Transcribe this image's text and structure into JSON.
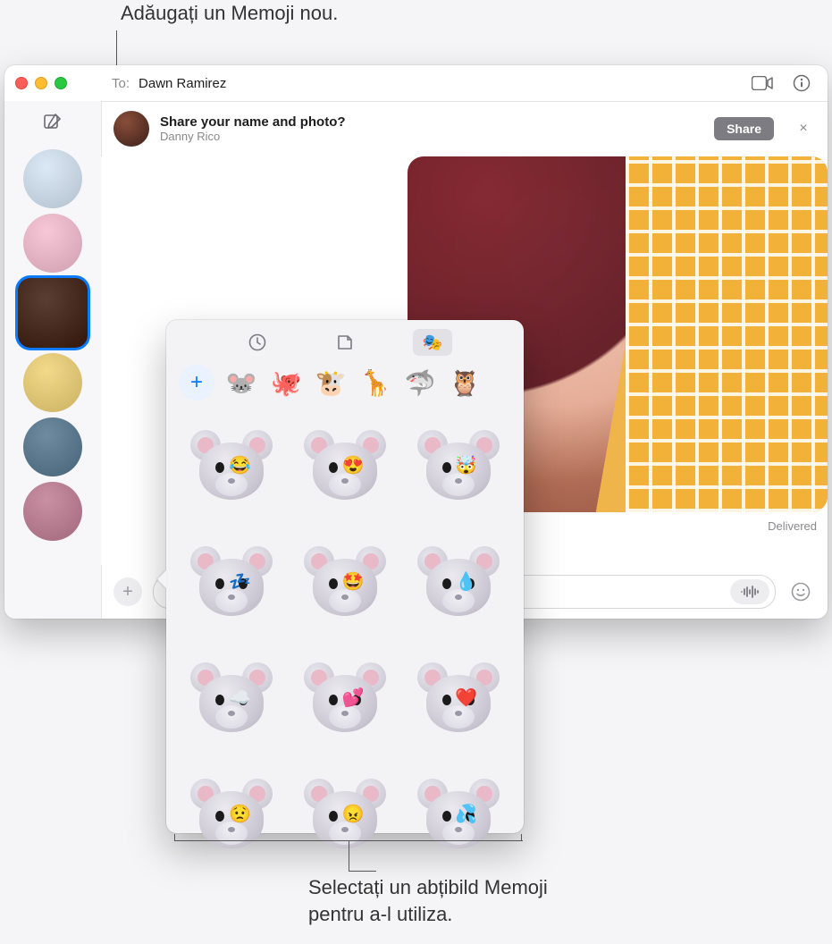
{
  "callouts": {
    "top": "Adăugați un Memoji nou.",
    "bottom_line1": "Selectați un abțibild Memoji",
    "bottom_line2": "pentru a-l utiliza."
  },
  "window": {
    "traffic": [
      "close",
      "minimize",
      "zoom"
    ]
  },
  "toField": {
    "label": "To:",
    "recipient": "Dawn Ramirez"
  },
  "toolbarRight": {
    "facetime_icon": "facetime-icon",
    "info_icon": "info-icon"
  },
  "banner": {
    "title": "Share your name and photo?",
    "subtitle": "Danny Rico",
    "share_label": "Share",
    "close_label": "×"
  },
  "status": {
    "delivered": "Delivered"
  },
  "inputBar": {
    "apps_label": "+",
    "placeholder": "",
    "voice_icon": "voice-icon",
    "emoji_icon": "emoji-icon"
  },
  "sidebar": {
    "compose_icon": "compose-icon",
    "contacts": [
      {
        "name": "group-conversation",
        "selected": false,
        "color": "#dbe8f5"
      },
      {
        "name": "contact-pink-memoji",
        "selected": false,
        "color": "#f7c7d7"
      },
      {
        "name": "contact-dawn-ramirez",
        "selected": true,
        "color": "#5a3e34"
      },
      {
        "name": "contact-yellow-glasses",
        "selected": false,
        "color": "#f2d98a"
      },
      {
        "name": "contact-photo-man",
        "selected": false,
        "color": "#6e8ba0"
      },
      {
        "name": "contact-photo-woman",
        "selected": false,
        "color": "#c98fa3"
      }
    ]
  },
  "popover": {
    "segments": [
      {
        "name": "recents-tab",
        "icon": "clock-icon",
        "active": false
      },
      {
        "name": "stickers-tab",
        "icon": "sticker-icon",
        "active": false
      },
      {
        "name": "memoji-tab",
        "icon": "memoji-icon",
        "active": true
      }
    ],
    "avatar_row": {
      "add_label": "+",
      "avatars": [
        {
          "name": "memoji-mouse",
          "glyph": "🐭"
        },
        {
          "name": "memoji-octopus",
          "glyph": "🐙"
        },
        {
          "name": "memoji-cow",
          "glyph": "🐮"
        },
        {
          "name": "memoji-giraffe",
          "glyph": "🦒"
        },
        {
          "name": "memoji-shark",
          "glyph": "🦈"
        },
        {
          "name": "memoji-owl",
          "glyph": "🦉"
        }
      ]
    },
    "stickers": [
      {
        "name": "mouse-laughing-tears",
        "overlay": "😂"
      },
      {
        "name": "mouse-heart-eyes",
        "overlay": "😍"
      },
      {
        "name": "mouse-mind-blown",
        "overlay": "🤯"
      },
      {
        "name": "mouse-sleeping",
        "overlay": "💤"
      },
      {
        "name": "mouse-starstruck",
        "overlay": "🤩"
      },
      {
        "name": "mouse-tear",
        "overlay": "💧"
      },
      {
        "name": "mouse-head-in-clouds",
        "overlay": "☁️"
      },
      {
        "name": "mouse-blowing-kiss",
        "overlay": "💕"
      },
      {
        "name": "mouse-hearts",
        "overlay": "❤️"
      },
      {
        "name": "mouse-worried",
        "overlay": "😟"
      },
      {
        "name": "mouse-angry",
        "overlay": "😠"
      },
      {
        "name": "mouse-cold-sweat",
        "overlay": "💦"
      }
    ]
  }
}
